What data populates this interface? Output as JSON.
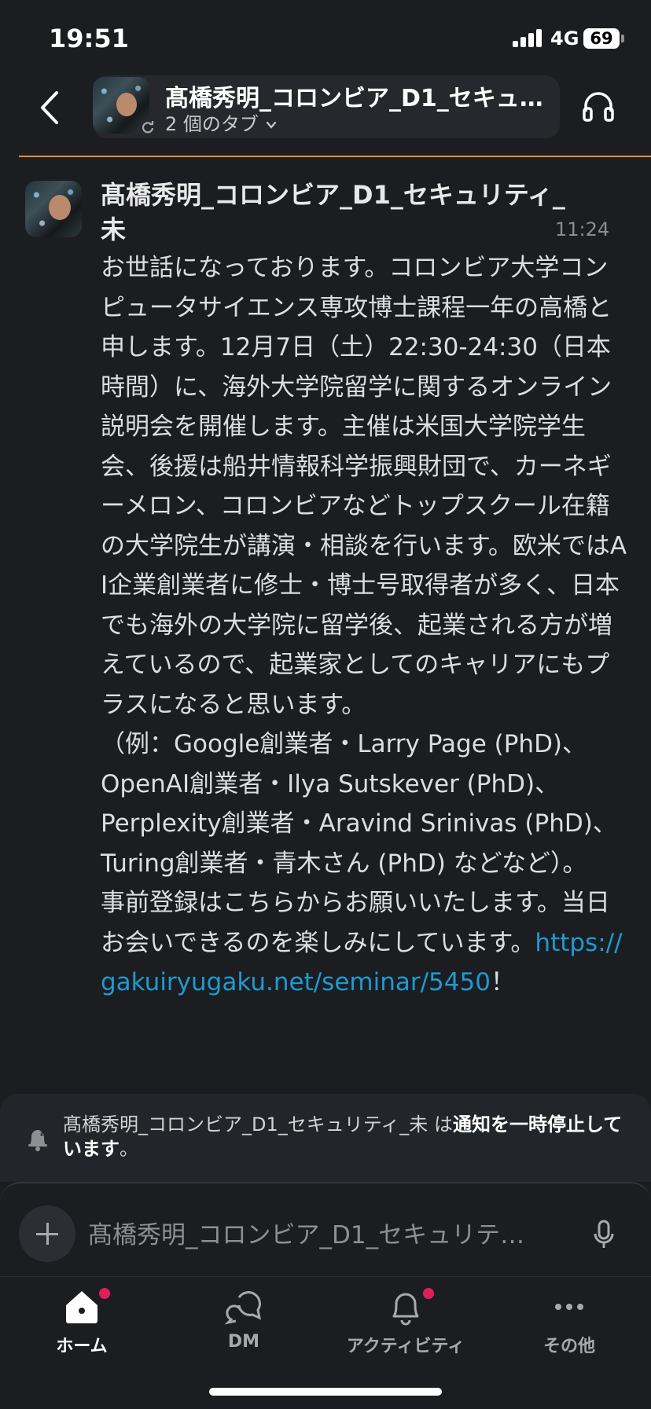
{
  "status_bar": {
    "time": "19:51",
    "network": "4G",
    "battery": "69"
  },
  "header": {
    "channel_title": "髙橋秀明_コロンビア_D1_セキュ…",
    "subtitle": "2 個のタブ"
  },
  "message": {
    "sender": "髙橋秀明_コロンビア_D1_セキュリティ_未",
    "time": "11:24",
    "body_text": "お世話になっております。コロンビア大学コンピュータサイエンス専攻博士課程一年の高橋と申します。12月7日（土）22:30-24:30（日本時間）に、海外大学院留学に関するオンライン説明会を開催します。主催は米国大学院学生会、後援は船井情報科学振興財団で、カーネギーメロン、コロンビアなどトップスクール在籍の大学院生が講演・相談を行います。欧米ではAI企業創業者に修士・博士号取得者が多く、日本でも海外の大学院に留学後、起業される方が増えているので、起業家としてのキャリアにもプラスになると思います。",
    "examples": [
      "（例：Google創業者・Larry Page (PhD)、",
      "OpenAI創業者・Ilya Sutskever (PhD)、",
      "Perplexity創業者・Aravind Srinivas (PhD)、",
      "Turing創業者・青木さん (PhD) などなど）。"
    ],
    "closing_text": "事前登録はこちらからお願いいたします。当日お会いできるのを楽しみにしています。",
    "link": "https://gakuiryugaku.net/seminar/5450",
    "link_suffix": "！"
  },
  "notice": {
    "prefix": "髙橋秀明_コロンビア_D1_セキュリティ_未 は",
    "bold": "通知を一時停止しています",
    "suffix": "。"
  },
  "composer": {
    "placeholder": "髙橋秀明_コロンビア_D1_セキュリテ…"
  },
  "tabs": {
    "home": "ホーム",
    "dm": "DM",
    "activity": "アクティビティ",
    "more": "その他"
  },
  "colors": {
    "background": "#1b1d21",
    "link": "#1d9bd1",
    "badge": "#e01e5a",
    "unread_line": "#e8912d"
  },
  "icons": [
    "back-chevron-icon",
    "sync-icon",
    "chevron-down-icon",
    "headphones-icon",
    "bell-snooze-icon",
    "plus-icon",
    "microphone-icon",
    "home-icon",
    "dm-icon",
    "bell-icon",
    "more-icon"
  ]
}
